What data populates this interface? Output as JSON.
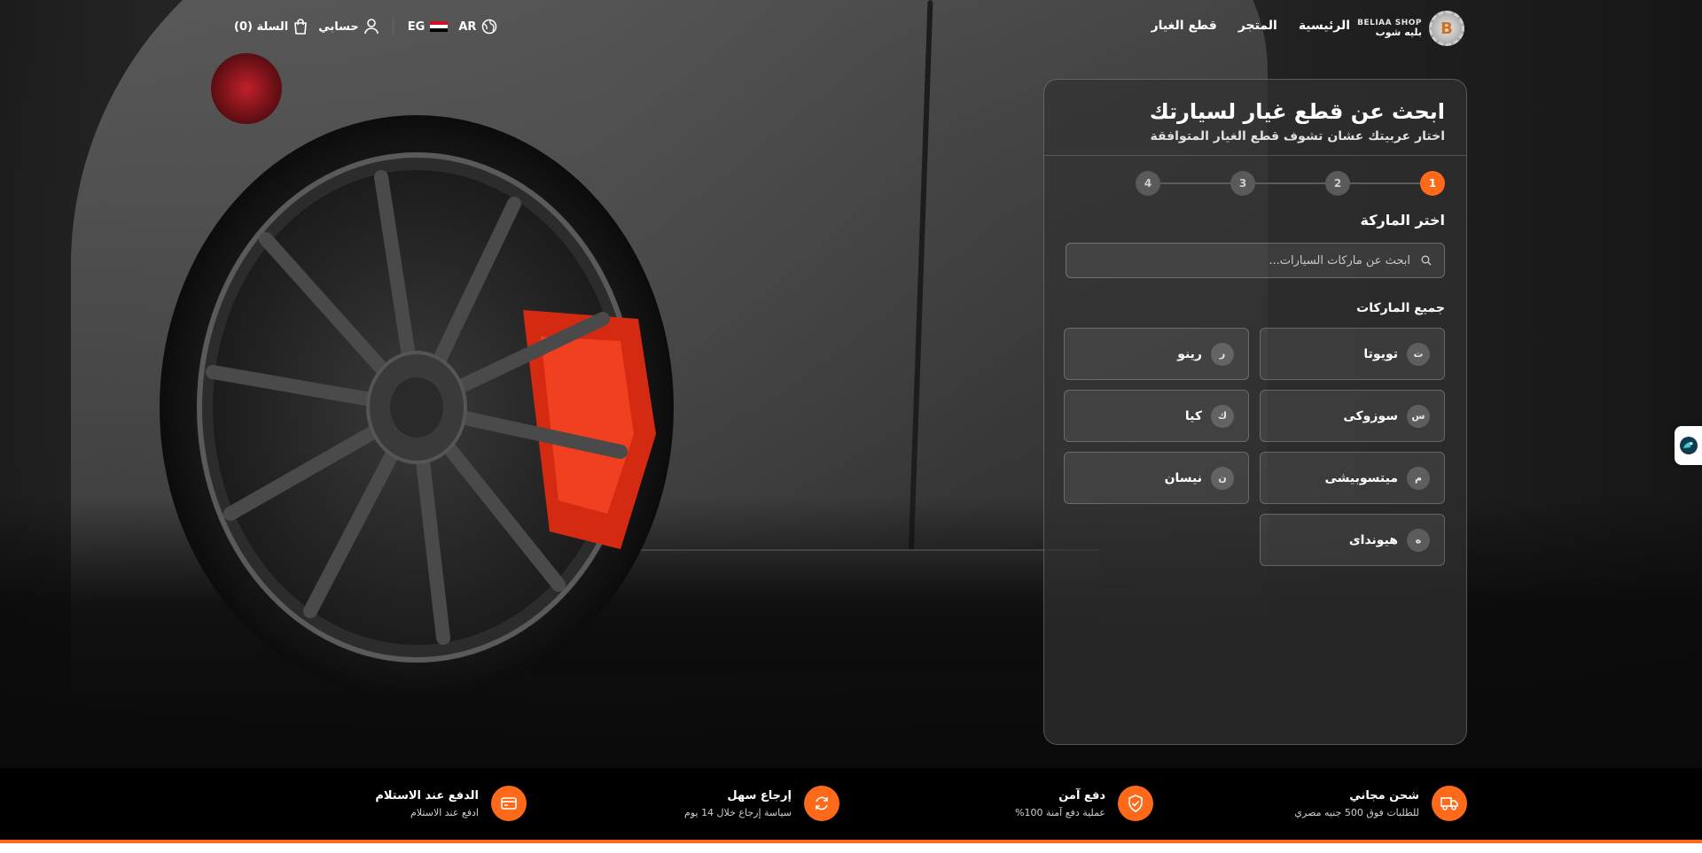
{
  "header": {
    "logo": {
      "en": "BELIAA SHOP",
      "ar": "بليه شوب",
      "mark": "B"
    },
    "nav": [
      {
        "label": "الرئيسية"
      },
      {
        "label": "المتجر"
      },
      {
        "label": "قطع الغيار"
      }
    ],
    "language": "AR",
    "country": "EG",
    "account_label": "حسابي",
    "cart_label": "السلة (0)"
  },
  "finder": {
    "title": "ابحث عن قطع غيار لسيارتك",
    "subtitle": "اختار عربيتك عشان تشوف قطع الغيار المتوافقة",
    "steps": [
      "1",
      "2",
      "3",
      "4"
    ],
    "active_step": 1,
    "step_title": "اختر الماركة",
    "search_placeholder": "ابحث عن ماركات السيارات...",
    "all_brands_label": "جميع الماركات",
    "brands": [
      {
        "letter": "ت",
        "name": "تويوتا"
      },
      {
        "letter": "ر",
        "name": "رينو"
      },
      {
        "letter": "س",
        "name": "سوزوكى"
      },
      {
        "letter": "ك",
        "name": "كيا"
      },
      {
        "letter": "م",
        "name": "ميتسوبيشى"
      },
      {
        "letter": "ن",
        "name": "نيسان"
      },
      {
        "letter": "ه",
        "name": "هيونداى"
      }
    ]
  },
  "features": [
    {
      "title": "شحن مجاني",
      "subtitle": "للطلبات فوق 500 جنيه مصري",
      "icon": "truck-icon"
    },
    {
      "title": "دفع آمن",
      "subtitle": "عملية دفع آمنة 100%",
      "icon": "shield-check-icon"
    },
    {
      "title": "إرجاع سهل",
      "subtitle": "سياسة إرجاع خلال 14 يوم",
      "icon": "refresh-icon"
    },
    {
      "title": "الدفع عند الاستلام",
      "subtitle": "ادفع عند الاستلام",
      "icon": "credit-card-icon"
    }
  ],
  "colors": {
    "accent": "#ff6a1a",
    "panel": "#303030",
    "strip": "#000000"
  }
}
